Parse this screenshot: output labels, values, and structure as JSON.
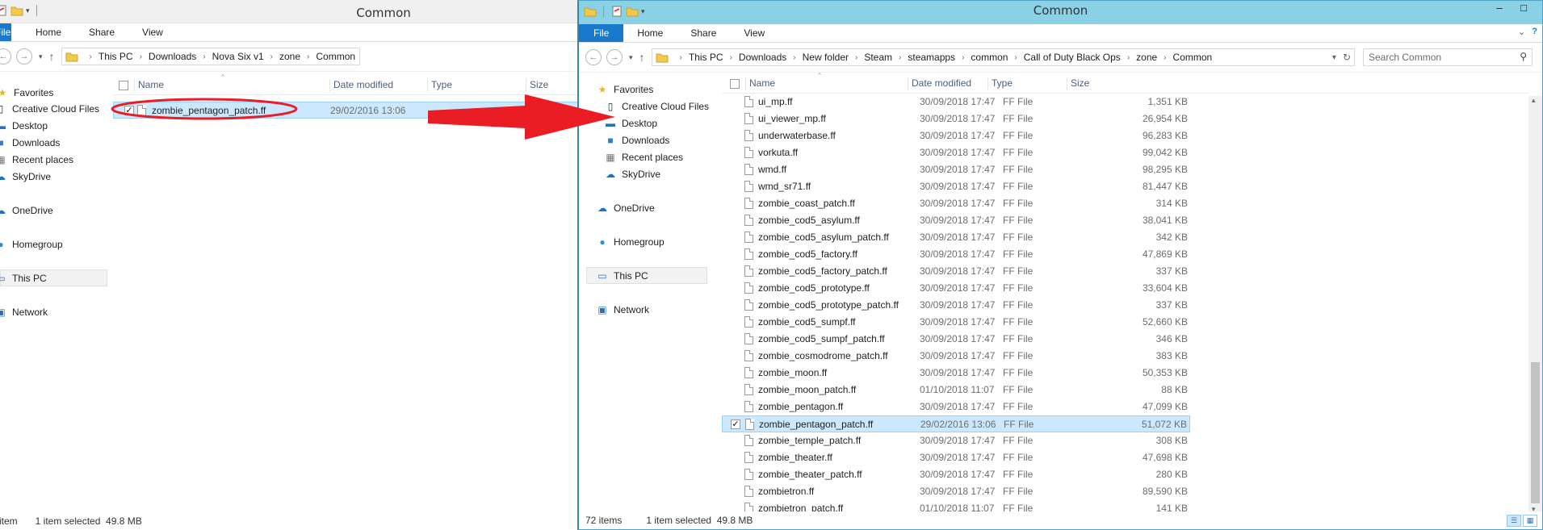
{
  "icons": {
    "folder": "folder-icon",
    "file": "file-icon",
    "star": "star-icon"
  },
  "colors": {
    "file_tab": "#1979ca",
    "selection": "#cce8ff",
    "titlebar_active": "#8ad1e6",
    "arrow": "#ea1c24"
  },
  "left_window": {
    "title": "Common",
    "ribbon": {
      "file": "File",
      "home": "Home",
      "share": "Share",
      "view": "View"
    },
    "breadcrumb": [
      "This PC",
      "Downloads",
      "Nova Six v1",
      "zone",
      "Common"
    ],
    "nav": {
      "favorites": "Favorites",
      "creative_cloud": "Creative Cloud Files",
      "desktop": "Desktop",
      "downloads": "Downloads",
      "recent": "Recent places",
      "skydrive": "SkyDrive",
      "onedrive": "OneDrive",
      "homegroup": "Homegroup",
      "thispc": "This PC",
      "network": "Network"
    },
    "columns": {
      "name": "Name",
      "date": "Date modified",
      "type": "Type",
      "size": "Size"
    },
    "files": [
      {
        "name": "zombie_pentagon_patch.ff",
        "date": "29/02/2016 13:06"
      }
    ],
    "status": {
      "count": "item",
      "selected": "1 item selected  49.8 MB"
    }
  },
  "right_window": {
    "title": "Common",
    "ribbon": {
      "file": "File",
      "home": "Home",
      "share": "Share",
      "view": "View"
    },
    "breadcrumb": [
      "This PC",
      "Downloads",
      "New folder",
      "Steam",
      "steamapps",
      "common",
      "Call of Duty Black Ops",
      "zone",
      "Common"
    ],
    "search_placeholder": "Search Common",
    "nav": {
      "favorites": "Favorites",
      "creative_cloud": "Creative Cloud Files",
      "desktop": "Desktop",
      "downloads": "Downloads",
      "recent": "Recent places",
      "skydrive": "SkyDrive",
      "onedrive": "OneDrive",
      "homegroup": "Homegroup",
      "thispc": "This PC",
      "network": "Network"
    },
    "columns": {
      "name": "Name",
      "date": "Date modified",
      "type": "Type",
      "size": "Size"
    },
    "files": [
      {
        "name": "ui_mp.ff",
        "date": "30/09/2018 17:47",
        "type": "FF File",
        "size": "1,351 KB"
      },
      {
        "name": "ui_viewer_mp.ff",
        "date": "30/09/2018 17:47",
        "type": "FF File",
        "size": "26,954 KB"
      },
      {
        "name": "underwaterbase.ff",
        "date": "30/09/2018 17:47",
        "type": "FF File",
        "size": "96,283 KB"
      },
      {
        "name": "vorkuta.ff",
        "date": "30/09/2018 17:47",
        "type": "FF File",
        "size": "99,042 KB"
      },
      {
        "name": "wmd.ff",
        "date": "30/09/2018 17:47",
        "type": "FF File",
        "size": "98,295 KB"
      },
      {
        "name": "wmd_sr71.ff",
        "date": "30/09/2018 17:47",
        "type": "FF File",
        "size": "81,447 KB"
      },
      {
        "name": "zombie_coast_patch.ff",
        "date": "30/09/2018 17:47",
        "type": "FF File",
        "size": "314 KB"
      },
      {
        "name": "zombie_cod5_asylum.ff",
        "date": "30/09/2018 17:47",
        "type": "FF File",
        "size": "38,041 KB"
      },
      {
        "name": "zombie_cod5_asylum_patch.ff",
        "date": "30/09/2018 17:47",
        "type": "FF File",
        "size": "342 KB"
      },
      {
        "name": "zombie_cod5_factory.ff",
        "date": "30/09/2018 17:47",
        "type": "FF File",
        "size": "47,869 KB"
      },
      {
        "name": "zombie_cod5_factory_patch.ff",
        "date": "30/09/2018 17:47",
        "type": "FF File",
        "size": "337 KB"
      },
      {
        "name": "zombie_cod5_prototype.ff",
        "date": "30/09/2018 17:47",
        "type": "FF File",
        "size": "33,604 KB"
      },
      {
        "name": "zombie_cod5_prototype_patch.ff",
        "date": "30/09/2018 17:47",
        "type": "FF File",
        "size": "337 KB"
      },
      {
        "name": "zombie_cod5_sumpf.ff",
        "date": "30/09/2018 17:47",
        "type": "FF File",
        "size": "52,660 KB"
      },
      {
        "name": "zombie_cod5_sumpf_patch.ff",
        "date": "30/09/2018 17:47",
        "type": "FF File",
        "size": "346 KB"
      },
      {
        "name": "zombie_cosmodrome_patch.ff",
        "date": "30/09/2018 17:47",
        "type": "FF File",
        "size": "383 KB"
      },
      {
        "name": "zombie_moon.ff",
        "date": "30/09/2018 17:47",
        "type": "FF File",
        "size": "50,353 KB"
      },
      {
        "name": "zombie_moon_patch.ff",
        "date": "01/10/2018 11:07",
        "type": "FF File",
        "size": "88 KB"
      },
      {
        "name": "zombie_pentagon.ff",
        "date": "30/09/2018 17:47",
        "type": "FF File",
        "size": "47,099 KB"
      },
      {
        "name": "zombie_pentagon_patch.ff",
        "date": "29/02/2016 13:06",
        "type": "FF File",
        "size": "51,072 KB",
        "selected": true
      },
      {
        "name": "zombie_temple_patch.ff",
        "date": "30/09/2018 17:47",
        "type": "FF File",
        "size": "308 KB"
      },
      {
        "name": "zombie_theater.ff",
        "date": "30/09/2018 17:47",
        "type": "FF File",
        "size": "47,698 KB"
      },
      {
        "name": "zombie_theater_patch.ff",
        "date": "30/09/2018 17:47",
        "type": "FF File",
        "size": "280 KB"
      },
      {
        "name": "zombietron.ff",
        "date": "30/09/2018 17:47",
        "type": "FF File",
        "size": "89,590 KB"
      },
      {
        "name": "zombietron_patch.ff",
        "date": "01/10/2018 11:07",
        "type": "FF File",
        "size": "141 KB"
      }
    ],
    "status": {
      "count": "72 items",
      "selected": "1 item selected  49.8 MB"
    }
  }
}
